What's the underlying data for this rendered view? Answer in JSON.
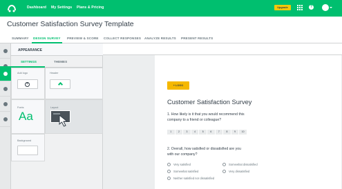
{
  "topbar": {
    "nav": [
      "Dashboard",
      "My Settings",
      "Plans & Pricing"
    ],
    "upgrade_label": "Upgrade",
    "help_label": "?",
    "colors": {
      "brand": "#00bf6f",
      "upgrade": "#f5c90a"
    }
  },
  "page": {
    "title": "Customer Satisfaction Survey Template"
  },
  "tabs": [
    "SUMMARY",
    "DESIGN SURVEY",
    "PREVIEW & SCORE",
    "COLLECT RESPONSES",
    "ANALYZE RESULTS",
    "PRESENT RESULTS"
  ],
  "active_tab": "DESIGN SURVEY",
  "panel": {
    "title": "APPEARANCE",
    "subtabs": [
      "SETTINGS",
      "THEMES"
    ],
    "active_subtab": "SETTINGS",
    "cells": {
      "logo": "Add logo",
      "header": "Header",
      "font": "Fonts",
      "font_sample": "Aa",
      "layout": "Layout",
      "background": "Background"
    }
  },
  "survey": {
    "logo_button": "+ LOGO",
    "title": "Customer Satisfaction Survey",
    "q1": {
      "line1": "1. How likely is it that you would recommend this",
      "line2": "company to a friend or colleague?",
      "scale": [
        "1",
        "2",
        "3",
        "4",
        "5",
        "6",
        "7",
        "8",
        "9",
        "10"
      ]
    },
    "q2": {
      "line1": "2. Overall, how satisfied or dissatisfied are you",
      "line2": "with our company?",
      "options": [
        "Very satisfied",
        "Somewhat dissatisfied",
        "Somewhat satisfied",
        "Very dissatisfied",
        "Neither satisfied nor dissatisfied"
      ]
    }
  }
}
